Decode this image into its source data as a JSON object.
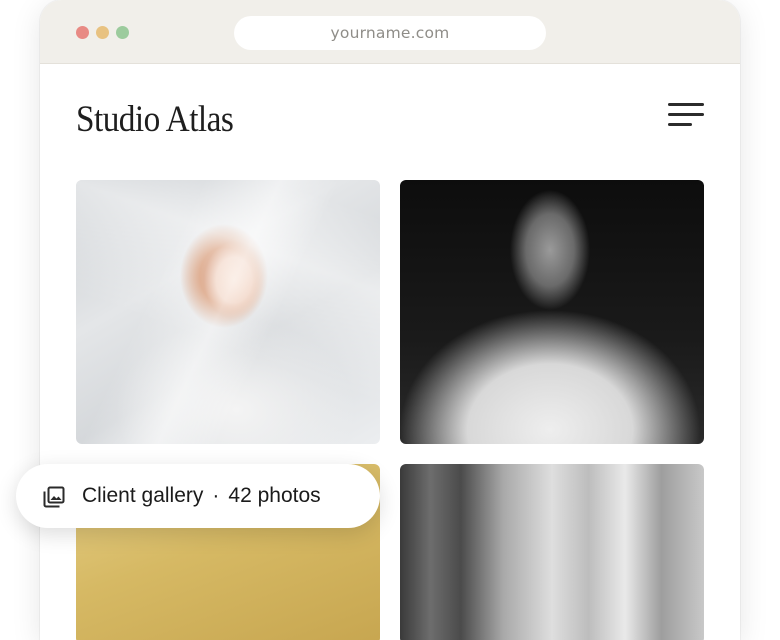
{
  "browser": {
    "url": "yourname.com",
    "traffic_lights": {
      "close": "#e88a84",
      "minimize": "#e8c281",
      "maximize": "#9ccb9d"
    }
  },
  "site": {
    "title": "Studio Atlas",
    "menu_icon": "hamburger-menu-icon"
  },
  "gallery": {
    "photos": [
      {
        "subject": "red-haired woman behind white veil"
      },
      {
        "subject": "bride in strapless gown, black and white"
      },
      {
        "subject": "golden yellow fabric"
      },
      {
        "subject": "white dress and sheer curtains, black and white"
      }
    ]
  },
  "badge": {
    "icon": "photo-library-icon",
    "label": "Client gallery",
    "separator": "·",
    "count": "42 photos"
  }
}
